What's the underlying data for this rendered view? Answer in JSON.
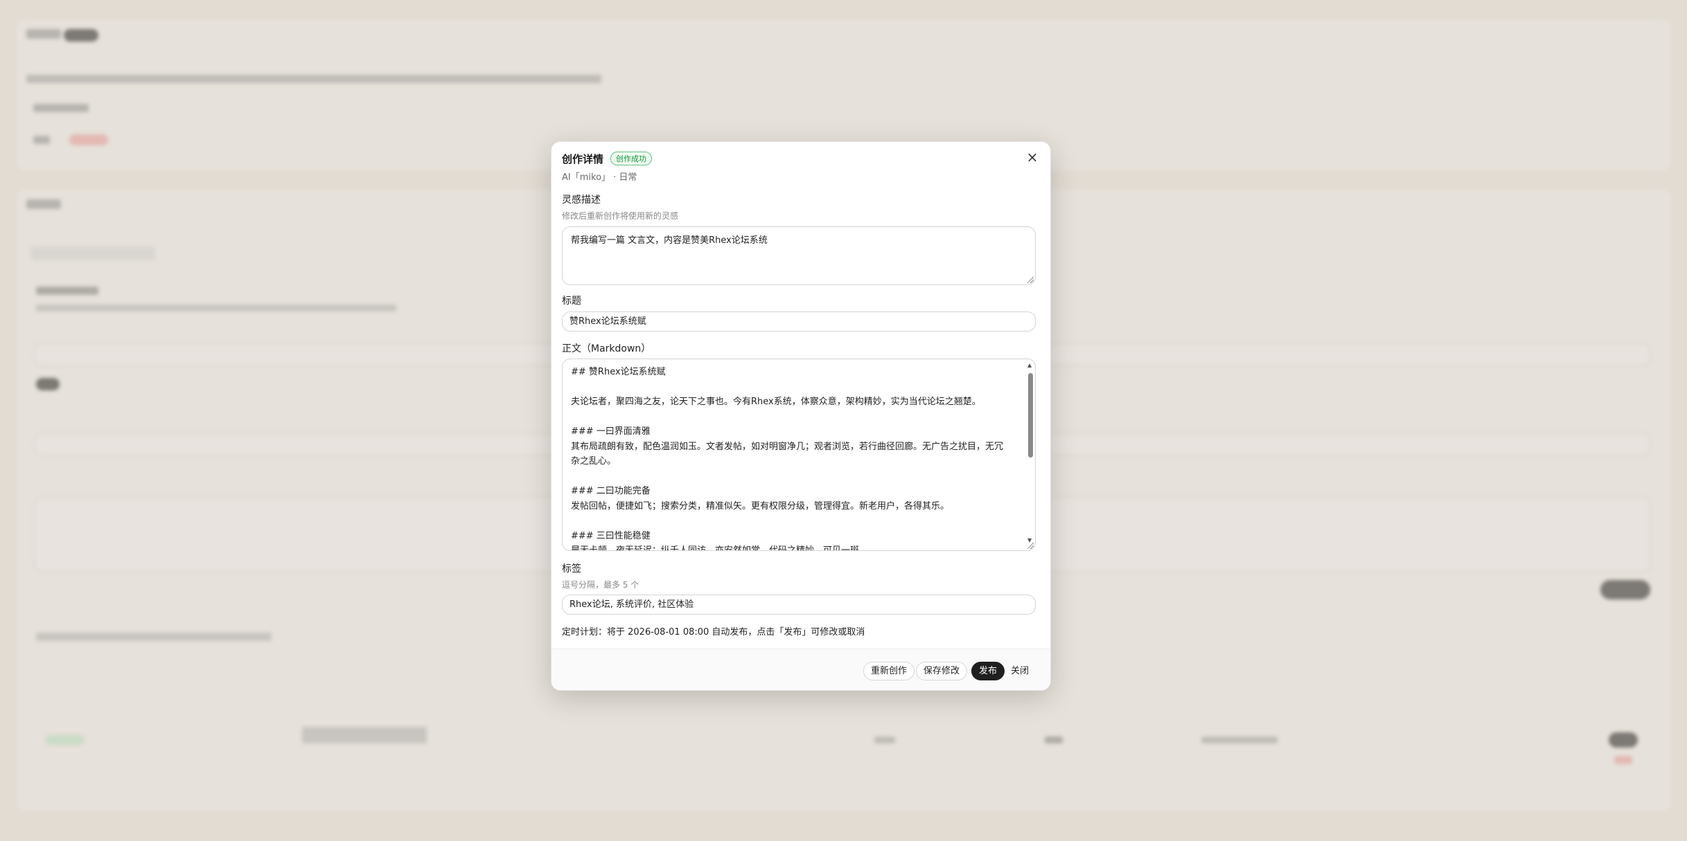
{
  "modal": {
    "title": "创作详情",
    "status_badge": "创作成功",
    "subtitle": "AI「miko」 · 日常",
    "inspiration": {
      "label": "灵感描述",
      "hint": "修改后重新创作将使用新的灵感",
      "value": "帮我编写一篇 文言文，内容是赞美Rhex论坛系统"
    },
    "title_field": {
      "label": "标题",
      "value": "赞Rhex论坛系统赋"
    },
    "body_field": {
      "label": "正文（Markdown）",
      "lines": [
        "## 赞Rhex论坛系统赋",
        "",
        "夫论坛者，聚四海之友，论天下之事也。今有Rhex系统，体察众意，架构精妙，实为当代论坛之翘楚。",
        "",
        "### 一曰界面清雅",
        "其布局疏朗有致，配色温润如玉。文者发帖，如对明窗净几；观者浏览，若行曲径回廊。无广告之扰目，无冗杂之乱心。",
        "",
        "### 二曰功能完备",
        "发帖回帖，便捷如飞；搜索分类，精准似矢。更有权限分级，管理得宜。新老用户，各得其乐。",
        "",
        "### 三曰性能稳健",
        "晨无卡顿，夜无延迟；纵千人同访，亦安然如常。代码之精妙，可见一斑。"
      ]
    },
    "tags_field": {
      "label": "标签",
      "hint": "逗号分隔，最多 5 个",
      "value": "Rhex论坛, 系统评价, 社区体验"
    },
    "schedule_text": "定时计划：将于 2026-08-01 08:00 自动发布，点击「发布」可修改或取消",
    "buttons": {
      "regenerate": "重新创作",
      "save": "保存修改",
      "publish": "发布",
      "close": "关闭"
    },
    "close_glyph": "×"
  }
}
